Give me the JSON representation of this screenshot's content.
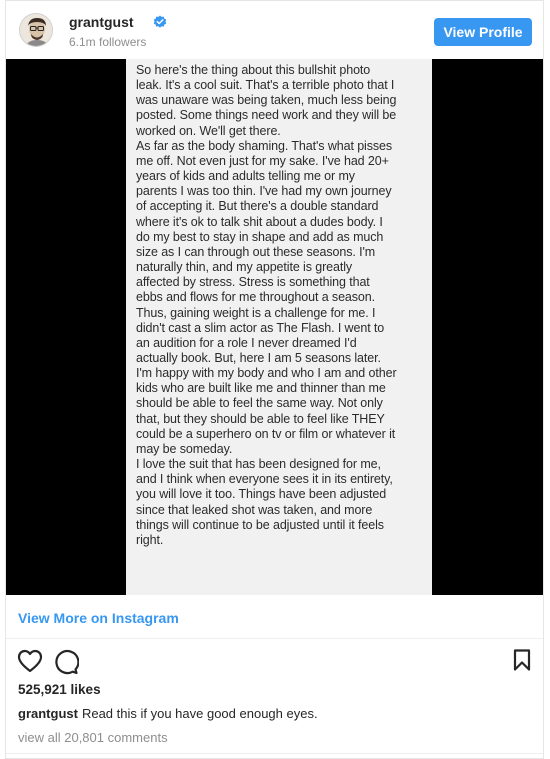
{
  "header": {
    "username": "grantgust",
    "followers": "6.1m followers",
    "view_profile_label": "View Profile",
    "verified_icon": "verified-badge-icon",
    "verified_color": "#3897f0"
  },
  "post": {
    "note_text": "So here's the thing about this bullshit photo\nleak. It's a cool suit. That's a terrible photo that I\nwas unaware was being taken, much less being\nposted. Some things need work and they will be\nworked on. We'll get there.\nAs far as the body shaming. That's what pisses\nme off. Not even just for my sake. I've had 20+\nyears of kids and adults telling me or my\nparents I was too thin. I've had my own journey\nof accepting it. But there's a double standard\nwhere it's ok to talk shit about a dudes body. I\ndo my best to stay in shape and add as much\nsize as I can through out these seasons. I'm\nnaturally thin, and my appetite is greatly\naffected by stress. Stress is something that\nebbs and flows for me throughout a season.\nThus, gaining weight is a challenge for me. I\ndidn't cast a slim actor as The Flash. I went to\nan audition for a role I never dreamed I'd\nactually book. But, here I am 5 seasons later.\nI'm happy with my body and who I am and other\nkids who are built like me and thinner than me\nshould be able to feel the same way. Not only\nthat, but they should be able to feel like THEY\ncould be a superhero on tv or film or whatever it\nmay be someday.\nI love the suit that has been designed for me,\nand I think when everyone sees it in its entirety,\nyou will love it too. Things have been adjusted\nsince that leaked shot was taken, and more\nthings will continue to be adjusted until it feels\nright."
  },
  "view_more_label": "View More on Instagram",
  "actions": {
    "like_icon": "heart-icon",
    "comment_icon": "comment-icon",
    "save_icon": "bookmark-icon"
  },
  "likes": "525,921 likes",
  "caption": {
    "username": "grantgust",
    "text": "Read this if you have good enough eyes."
  },
  "comments_link": "view all 20,801 comments",
  "colors": {
    "accent": "#3897f0",
    "muted": "#8e8e8e",
    "text": "#262626"
  }
}
